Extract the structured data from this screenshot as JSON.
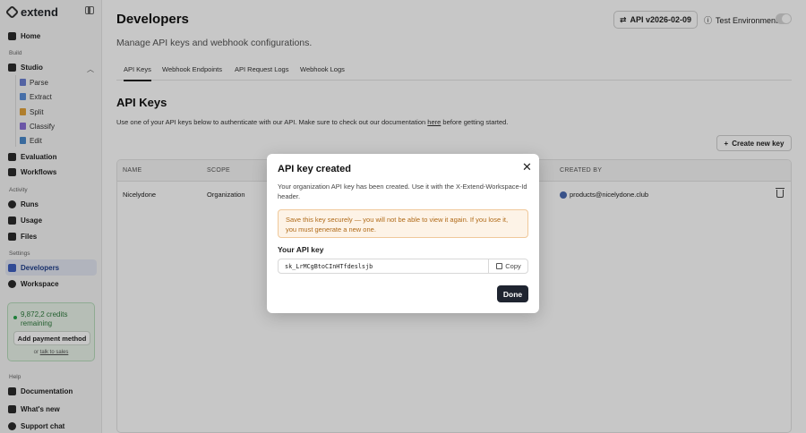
{
  "app": {
    "brand": "extend"
  },
  "sidebar": {
    "home": "Home",
    "build_label": "Build",
    "studio": "Studio",
    "studio_items": [
      "Parse",
      "Extract",
      "Split",
      "Classify",
      "Edit"
    ],
    "evaluation": "Evaluation",
    "workflows": "Workflows",
    "activity_label": "Activity",
    "runs": "Runs",
    "usage": "Usage",
    "files": "Files",
    "settings_label": "Settings",
    "developers": "Developers",
    "workspace": "Workspace",
    "help_label": "Help",
    "documentation": "Documentation",
    "whats_new": "What's new",
    "support_chat": "Support chat",
    "credits": {
      "amount": "9,872,2 credits remaining",
      "pay_button": "Add payment method",
      "or": "or",
      "talk_link": "talk to sales"
    }
  },
  "header": {
    "title": "Developers",
    "subtitle": "Manage API keys and webhook configurations.",
    "api_version": "API v2026-02-09",
    "test_env": "Test Environment"
  },
  "tabs": [
    "API Keys",
    "Webhook Endpoints",
    "API Request Logs",
    "Webhook Logs"
  ],
  "section": {
    "title": "API Keys",
    "desc_before": "Use one of your API keys below to authenticate with our API. Make sure to check out our documentation",
    "desc_link": "here",
    "desc_after": "before getting started.",
    "create_button": "Create new key"
  },
  "table": {
    "headers": [
      "NAME",
      "SCOPE",
      "CREATED BY"
    ],
    "rows": [
      {
        "name": "Nicelydone",
        "scope": "Organization",
        "created_by": "products@nicelydone.club"
      }
    ]
  },
  "modal": {
    "title": "API key created",
    "description": "Your organization API key has been created. Use it with the X-Extend-Workspace-Id header.",
    "warning": "Save this key securely — you will not be able to view it again. If you lose it, you must generate a new one.",
    "key_label": "Your API key",
    "key_value": "sk_LrMCgBtoCInHTfdeslsjb",
    "copy": "Copy",
    "done": "Done"
  },
  "colors": {
    "accent": "#3e5fbf",
    "credits_green": "#2f7a3d",
    "warning_text": "#b06a18",
    "done_button": "#1f2430"
  }
}
